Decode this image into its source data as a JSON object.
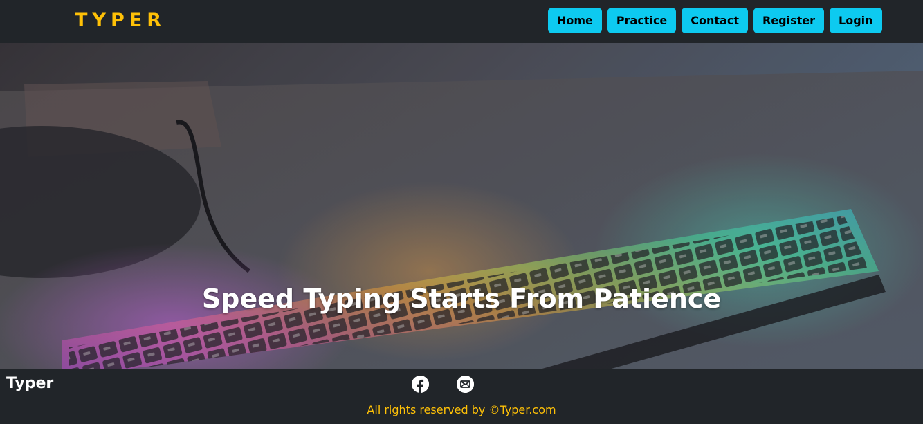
{
  "navbar": {
    "brand": "TYPER",
    "links": [
      "Home",
      "Practice",
      "Contact",
      "Register",
      "Login"
    ]
  },
  "hero": {
    "headline": "Speed Typing Starts From Patience",
    "background": "rgb-keyboard-photo"
  },
  "footer": {
    "brand": "Typer",
    "social_icons": [
      "facebook-icon",
      "mail-icon"
    ],
    "copyright": "All rights reserved by ©Typer.com"
  },
  "colors": {
    "accent": "#ffc107",
    "button": "#0dcaf0",
    "bar": "#212529"
  }
}
